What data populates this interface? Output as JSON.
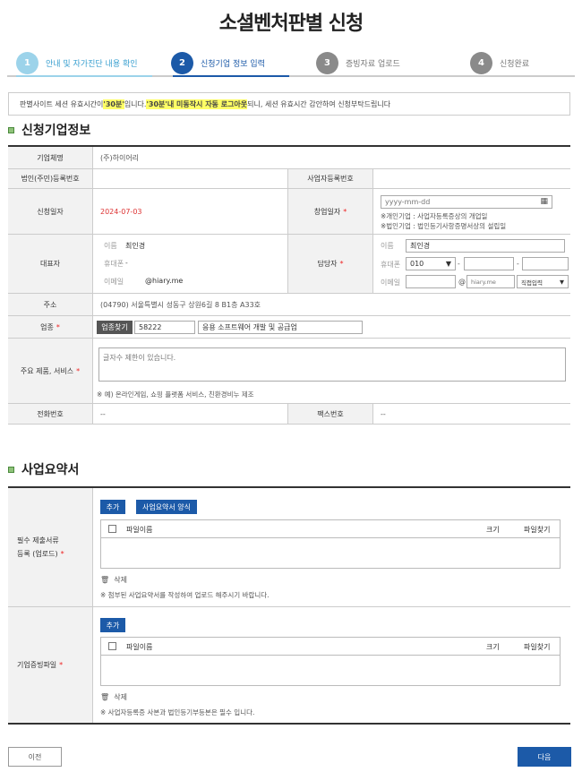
{
  "page": {
    "title": "소셜벤처판별 신청"
  },
  "steps": [
    {
      "num": "1",
      "label": "안내 및 자가진단 내용 확인"
    },
    {
      "num": "2",
      "label": "신청기업 정보 입력"
    },
    {
      "num": "3",
      "label": "증빙자료 업로드"
    },
    {
      "num": "4",
      "label": "신청완료"
    }
  ],
  "notice": {
    "part1": "판별사이트 세션 유효시간이 ",
    "hl1": "'30분'",
    "part2": "입니다. ",
    "hl2": "'30분'내 미동작시 자동 로그아웃",
    "part3": " 되니, 세션 유효시간 감안하여 신청부탁드립니다"
  },
  "company": {
    "section_title": "신청기업정보",
    "name_label": "기업체명",
    "name_value": "(주)하이어리",
    "corp_no_label": "법인(주민)등록번호",
    "biz_no_label": "사업자등록번호",
    "apply_date_label": "신청일자",
    "apply_date_value": "2024-07-03",
    "found_date_label": "창업일자",
    "found_date_placeholder": "yyyy-mm-dd",
    "found_note1": "※개인기업 : 사업자등록증상의 개업일",
    "found_note2": "※법인기업 : 법인등기사항증명서상의 설립일",
    "ceo_label": "대표자",
    "ceo_name_label": "이름",
    "ceo_name_value": "최인경",
    "ceo_phone_label": "휴대폰",
    "ceo_phone_value": "-",
    "ceo_email_label": "이메일",
    "ceo_email_value": "@hiary.me",
    "manager_label": "담당자",
    "mgr_name_label": "이름",
    "mgr_name_value": "최인경",
    "mgr_phone_label": "휴대폰",
    "mgr_phone_prefix": "010",
    "mgr_phone_sep": "-",
    "mgr_email_label": "이메일",
    "mgr_email_at": "@",
    "mgr_email_domain": "hiary.me",
    "mgr_email_select": "직접입력",
    "addr_label": "주소",
    "addr_value": "(04790) 서울특별시 성동구 상원6길 8 B1층 A33호",
    "industry_label": "업종",
    "industry_button": "업종찾기",
    "industry_code": "58222",
    "industry_name": "응용 소프트웨어 개발 및 공급업",
    "product_label": "주요 제품, 서비스",
    "product_placeholder": "글자수 제한이 있습니다.",
    "product_note": "※ 예) 온라인게임, 쇼핑 플랫폼 서비스, 친환경비누 제조",
    "tel_label": "전화번호",
    "tel_value": "--",
    "fax_label": "팩스번호",
    "fax_value": "--"
  },
  "summary": {
    "section_title": "사업요약서",
    "req_label_line1": "필수 제출서류",
    "req_label_line2": "등록 (업로드)",
    "add_button": "추가",
    "template_button": "사업요약서 양식",
    "col_filename": "파일이름",
    "col_size": "크기",
    "col_find": "파일찾기",
    "delete_label": "삭제",
    "req_note": "※ 첨부된 사업요약서를 작성하여 업로드 해주시기 바랍니다.",
    "evidence_label": "기업증빙파일",
    "add_button2": "추가",
    "evidence_note": "※ 사업자등록증 사본과 법인등기부등본은 필수 입니다."
  },
  "footer": {
    "prev_button": "이전",
    "next_button": "다음"
  },
  "colors": {
    "primary": "#1c5aa8",
    "done": "#9cd3ea",
    "required": "#e22222"
  }
}
